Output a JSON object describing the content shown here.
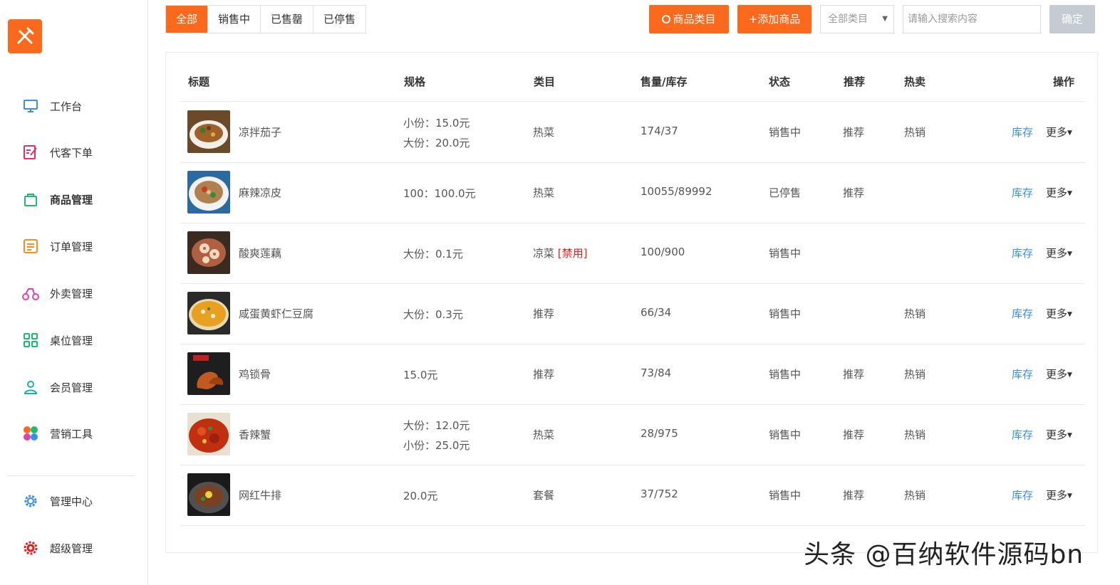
{
  "sidebar": {
    "items": [
      {
        "label": "工作台",
        "icon": "monitor-icon",
        "color": "#3a8ee6",
        "bold": false
      },
      {
        "label": "代客下单",
        "icon": "edit-note-icon",
        "color": "#e0306a",
        "bold": false
      },
      {
        "label": "商品管理",
        "icon": "shopping-bag-icon",
        "color": "#1cbc6c",
        "bold": true
      },
      {
        "label": "订单管理",
        "icon": "list-icon",
        "color": "#fb8c1c",
        "bold": false
      },
      {
        "label": "外卖管理",
        "icon": "scooter-icon",
        "color": "#e040b0",
        "bold": false
      },
      {
        "label": "桌位管理",
        "icon": "grid-icon",
        "color": "#1cbc6c",
        "bold": false
      },
      {
        "label": "会员管理",
        "icon": "user-icon",
        "color": "#1cb0a0",
        "bold": false
      },
      {
        "label": "营销工具",
        "icon": "petals-icon",
        "color": "#fb6a1c",
        "bold": false
      },
      {
        "label": "管理中心",
        "icon": "gear-icon",
        "color": "#3a8ee6",
        "bold": false
      },
      {
        "label": "超级管理",
        "icon": "gear-red-icon",
        "color": "#e02020",
        "bold": false
      }
    ]
  },
  "tabs": [
    "全部",
    "销售中",
    "已售罄",
    "已停售"
  ],
  "toolbar": {
    "category_button": "商品类目",
    "add_button": "+添加商品",
    "select_value": "全部类目",
    "search_placeholder": "请输入搜索内容",
    "confirm_button": "确定"
  },
  "table": {
    "headers": [
      "标题",
      "规格",
      "类目",
      "售量/库存",
      "状态",
      "推荐",
      "热卖",
      "操作"
    ],
    "rows": [
      {
        "title": "凉拌茄子",
        "spec": [
          "小份：15.0元",
          "大份：20.0元"
        ],
        "category": "热菜",
        "banned": "",
        "sales_stock": "174/37",
        "status": "销售中",
        "recommend": "推荐",
        "hot": "热销",
        "stock_link": "库存",
        "more": "更多"
      },
      {
        "title": "麻辣凉皮",
        "spec": [
          "100：100.0元"
        ],
        "category": "热菜",
        "banned": "",
        "sales_stock": "10055/89992",
        "status": "已停售",
        "recommend": "推荐",
        "hot": "",
        "stock_link": "库存",
        "more": "更多"
      },
      {
        "title": "酸爽莲藕",
        "spec": [
          "大份：0.1元"
        ],
        "category": "凉菜",
        "banned": "[禁用]",
        "sales_stock": "100/900",
        "status": "销售中",
        "recommend": "",
        "hot": "",
        "stock_link": "库存",
        "more": "更多"
      },
      {
        "title": "咸蛋黄虾仁豆腐",
        "spec": [
          "大份：0.3元"
        ],
        "category": "推荐",
        "banned": "",
        "sales_stock": "66/34",
        "status": "销售中",
        "recommend": "",
        "hot": "热销",
        "stock_link": "库存",
        "more": "更多"
      },
      {
        "title": "鸡锁骨",
        "spec": [
          "15.0元"
        ],
        "category": "推荐",
        "banned": "",
        "sales_stock": "73/84",
        "status": "销售中",
        "recommend": "推荐",
        "hot": "热销",
        "stock_link": "库存",
        "more": "更多"
      },
      {
        "title": "香辣蟹",
        "spec": [
          "大份：12.0元",
          "小份：25.0元"
        ],
        "category": "热菜",
        "banned": "",
        "sales_stock": "28/975",
        "status": "销售中",
        "recommend": "推荐",
        "hot": "热销",
        "stock_link": "库存",
        "more": "更多"
      },
      {
        "title": "网红牛排",
        "spec": [
          "20.0元"
        ],
        "category": "套餐",
        "banned": "",
        "sales_stock": "37/752",
        "status": "销售中",
        "recommend": "推荐",
        "hot": "热销",
        "stock_link": "库存",
        "more": "更多"
      }
    ]
  },
  "watermark": "头条 @百纳软件源码bn",
  "colors": {
    "accent": "#fb6a1c",
    "link": "#3a8ee6",
    "banned": "#e02020"
  }
}
